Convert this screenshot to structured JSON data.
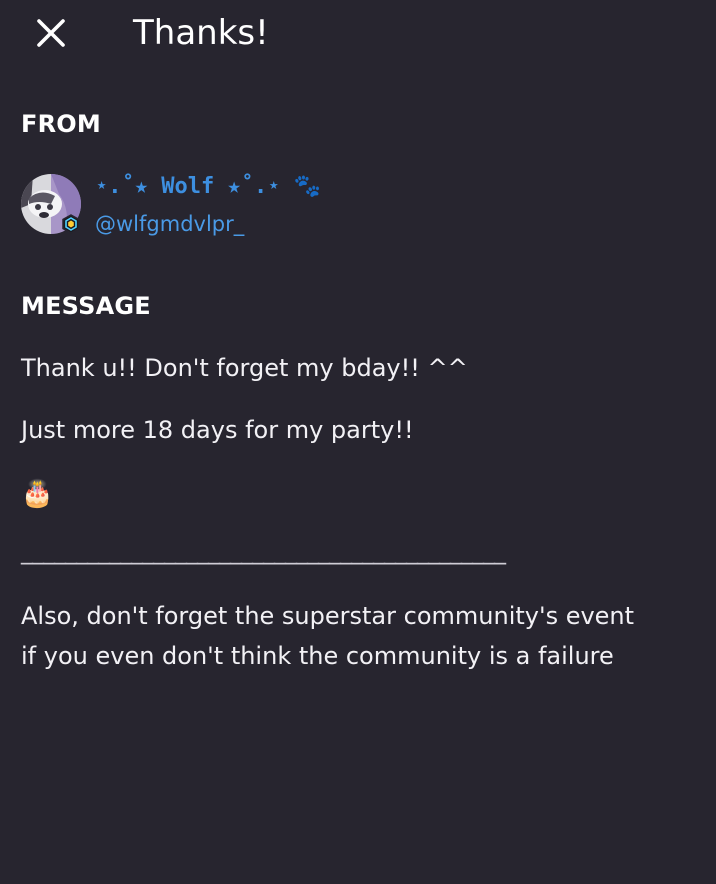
{
  "header": {
    "close_icon": "close-icon",
    "title": "Thanks!"
  },
  "from": {
    "label": "FROM",
    "sender": {
      "display_name": "⋆.˚★ Wolf ★˚.⋆ 🐾",
      "handle": "@wlfgmdvlpr_",
      "name_color": "#3d8fe0",
      "avatar_icon": "wolf-avatar-icon",
      "badge_icon": "hexagon-badge-icon"
    }
  },
  "message": {
    "label": "MESSAGE",
    "lines": [
      "Thank u!! Don't forget my bday!! ^^",
      "Just more 18 days for my party!!",
      "🎂",
      "____________________________________________",
      "Also, don't forget the superstar community's event",
      "if you even don't think the community is a failure"
    ]
  },
  "colors": {
    "background": "#27252f",
    "text": "#f2f1f5",
    "link": "#3d8fe0"
  }
}
